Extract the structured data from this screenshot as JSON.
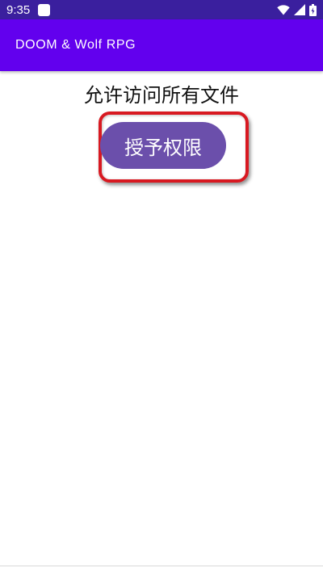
{
  "status_bar": {
    "time": "9:35",
    "icons": [
      "notification-icon",
      "wifi-icon",
      "signal-icon",
      "battery-icon"
    ]
  },
  "app_bar": {
    "title": "DOOM & Wolf RPG",
    "color": "#6200ee"
  },
  "content": {
    "message": "允许访问所有文件",
    "grant_button_label": "授予权限",
    "button_color": "#6b4fab",
    "highlight_color": "#d81921"
  }
}
